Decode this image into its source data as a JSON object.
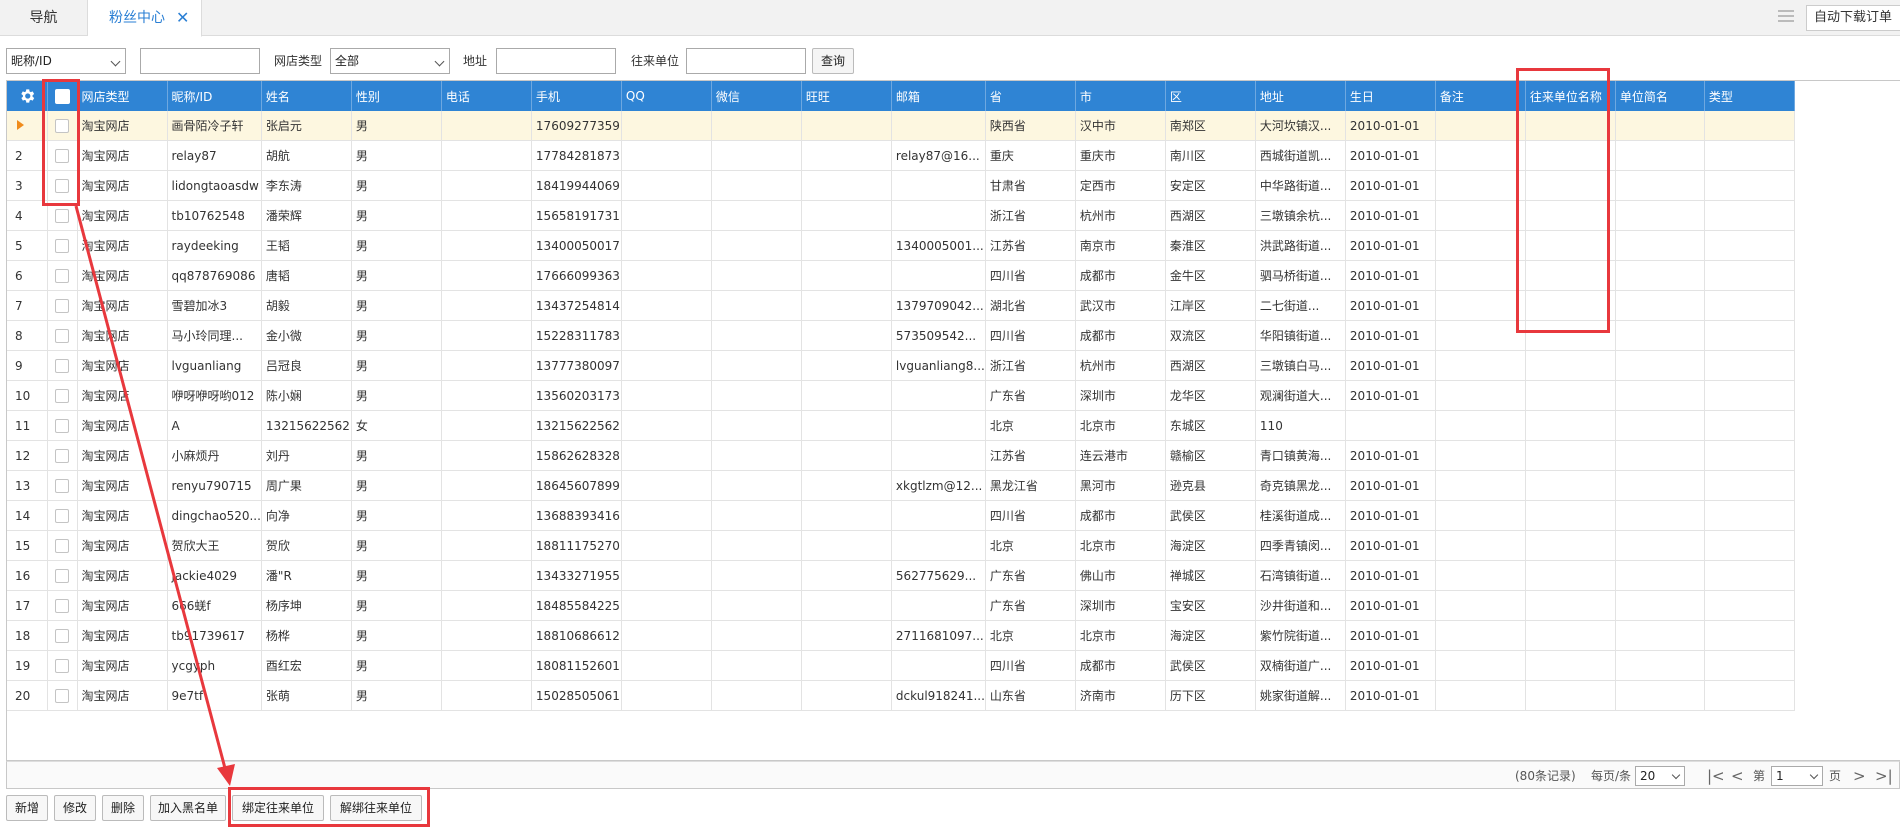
{
  "tabs": [
    {
      "label": "导航",
      "active": false
    },
    {
      "label": "粉丝中心",
      "active": true,
      "closable": true
    }
  ],
  "tab_close_glyph": "✕",
  "top_right": {
    "auto_download_label": "自动下载订单",
    "list_icon": "list-icon"
  },
  "filter": {
    "field_select": "昵称/ID",
    "keyword_value": "",
    "shop_type_label": "网店类型",
    "shop_type_value": "全部",
    "address_label": "地址",
    "address_value": "",
    "partner_label": "往来单位",
    "partner_value": "",
    "query_button": "查询"
  },
  "grid": {
    "gear_icon": "gear-icon",
    "columns": [
      "网店类型",
      "昵称/ID",
      "姓名",
      "性别",
      "电话",
      "手机",
      "QQ",
      "微信",
      "旺旺",
      "邮箱",
      "省",
      "市",
      "区",
      "地址",
      "生日",
      "备注",
      "往来单位名称",
      "单位简名",
      "类型"
    ],
    "selected_row": 0,
    "rows": [
      {
        "idx": "1",
        "c": [
          "淘宝网店",
          "画骨陌冷子轩",
          "张启元",
          "男",
          "",
          "17609277359",
          "",
          "",
          "",
          "",
          "陕西省",
          "汉中市",
          "南郑区",
          "大河坎镇汉...",
          "2010-01-01",
          "",
          "",
          "",
          ""
        ]
      },
      {
        "idx": "2",
        "c": [
          "淘宝网店",
          "relay87",
          "胡航",
          "男",
          "",
          "17784281873",
          "",
          "",
          "",
          "relay87@16...",
          "重庆",
          "重庆市",
          "南川区",
          "西城街道凯...",
          "2010-01-01",
          "",
          "",
          "",
          ""
        ]
      },
      {
        "idx": "3",
        "c": [
          "淘宝网店",
          "lidongtaoasdw",
          "李东涛",
          "男",
          "",
          "18419944069",
          "",
          "",
          "",
          "",
          "甘肃省",
          "定西市",
          "安定区",
          "中华路街道...",
          "2010-01-01",
          "",
          "",
          "",
          ""
        ]
      },
      {
        "idx": "4",
        "c": [
          "淘宝网店",
          "tb10762548",
          "潘荣辉",
          "男",
          "",
          "15658191731",
          "",
          "",
          "",
          "",
          "浙江省",
          "杭州市",
          "西湖区",
          "三墩镇余杭...",
          "2010-01-01",
          "",
          "",
          "",
          ""
        ]
      },
      {
        "idx": "5",
        "c": [
          "淘宝网店",
          "raydeeking",
          "王韬",
          "男",
          "",
          "13400050017",
          "",
          "",
          "",
          "1340005001...",
          "江苏省",
          "南京市",
          "秦淮区",
          "洪武路街道...",
          "2010-01-01",
          "",
          "",
          "",
          ""
        ]
      },
      {
        "idx": "6",
        "c": [
          "淘宝网店",
          "qq878769086",
          "唐韬",
          "男",
          "",
          "17666099363",
          "",
          "",
          "",
          "",
          "四川省",
          "成都市",
          "金牛区",
          "驷马桥街道...",
          "2010-01-01",
          "",
          "",
          "",
          ""
        ]
      },
      {
        "idx": "7",
        "c": [
          "淘宝网店",
          "雪碧加冰3",
          "胡毅",
          "男",
          "",
          "13437254814",
          "",
          "",
          "",
          "1379709042...",
          "湖北省",
          "武汉市",
          "江岸区",
          "二七街道...",
          "2010-01-01",
          "",
          "",
          "",
          ""
        ]
      },
      {
        "idx": "8",
        "c": [
          "淘宝网店",
          "马小玲同理...",
          "金小微",
          "男",
          "",
          "15228311783",
          "",
          "",
          "",
          "573509542...",
          "四川省",
          "成都市",
          "双流区",
          "华阳镇街道...",
          "2010-01-01",
          "",
          "",
          "",
          ""
        ]
      },
      {
        "idx": "9",
        "c": [
          "淘宝网店",
          "lvguanliang",
          "吕冠良",
          "男",
          "",
          "13777380097",
          "",
          "",
          "",
          "lvguanliang8...",
          "浙江省",
          "杭州市",
          "西湖区",
          "三墩镇白马...",
          "2010-01-01",
          "",
          "",
          "",
          ""
        ]
      },
      {
        "idx": "10",
        "c": [
          "淘宝网店",
          "咿呀咿呀哟012",
          "陈小娴",
          "男",
          "",
          "13560203173",
          "",
          "",
          "",
          "",
          "广东省",
          "深圳市",
          "龙华区",
          "观澜街道大...",
          "2010-01-01",
          "",
          "",
          "",
          ""
        ]
      },
      {
        "idx": "11",
        "c": [
          "淘宝网店",
          "A",
          "13215622562",
          "女",
          "",
          "13215622562",
          "",
          "",
          "",
          "",
          "北京",
          "北京市",
          "东城区",
          "110",
          "",
          "",
          "",
          "",
          ""
        ]
      },
      {
        "idx": "12",
        "c": [
          "淘宝网店",
          "小麻烦丹",
          "刘丹",
          "男",
          "",
          "15862628328",
          "",
          "",
          "",
          "",
          "江苏省",
          "连云港市",
          "赣榆区",
          "青口镇黄海...",
          "2010-01-01",
          "",
          "",
          "",
          ""
        ]
      },
      {
        "idx": "13",
        "c": [
          "淘宝网店",
          "renyu790715",
          "周广果",
          "男",
          "",
          "18645607899",
          "",
          "",
          "",
          "xkgtlzm@12...",
          "黑龙江省",
          "黑河市",
          "逊克县",
          "奇克镇黑龙...",
          "2010-01-01",
          "",
          "",
          "",
          ""
        ]
      },
      {
        "idx": "14",
        "c": [
          "淘宝网店",
          "dingchao520...",
          "向净",
          "男",
          "",
          "13688393416",
          "",
          "",
          "",
          "",
          "四川省",
          "成都市",
          "武侯区",
          "桂溪街道成...",
          "2010-01-01",
          "",
          "",
          "",
          ""
        ]
      },
      {
        "idx": "15",
        "c": [
          "淘宝网店",
          "贺欣大王",
          "贺欣",
          "男",
          "",
          "18811175270",
          "",
          "",
          "",
          "",
          "北京",
          "北京市",
          "海淀区",
          "四季青镇闵...",
          "2010-01-01",
          "",
          "",
          "",
          ""
        ]
      },
      {
        "idx": "16",
        "c": [
          "淘宝网店",
          "jackie4029",
          "潘\"R",
          "男",
          "",
          "13433271955",
          "",
          "",
          "",
          "562775629...",
          "广东省",
          "佛山市",
          "禅城区",
          "石湾镇街道...",
          "2010-01-01",
          "",
          "",
          "",
          ""
        ]
      },
      {
        "idx": "17",
        "c": [
          "淘宝网店",
          "666蜣f",
          "杨序坤",
          "男",
          "",
          "18485584225",
          "",
          "",
          "",
          "",
          "广东省",
          "深圳市",
          "宝安区",
          "沙井街道和...",
          "2010-01-01",
          "",
          "",
          "",
          ""
        ]
      },
      {
        "idx": "18",
        "c": [
          "淘宝网店",
          "tb91739617",
          "杨桦",
          "男",
          "",
          "18810686612",
          "",
          "",
          "",
          "2711681097...",
          "北京",
          "北京市",
          "海淀区",
          "紫竹院街道...",
          "2010-01-01",
          "",
          "",
          "",
          ""
        ]
      },
      {
        "idx": "19",
        "c": [
          "淘宝网店",
          "ycgyph",
          "酉红宏",
          "男",
          "",
          "18081152601",
          "",
          "",
          "",
          "",
          "四川省",
          "成都市",
          "武侯区",
          "双楠街道广...",
          "2010-01-01",
          "",
          "",
          "",
          ""
        ]
      },
      {
        "idx": "20",
        "c": [
          "淘宝网店",
          "9e7tf",
          "张萌",
          "男",
          "",
          "15028505061",
          "",
          "",
          "",
          "dckul918241...",
          "山东省",
          "济南市",
          "历下区",
          "姚家街道解...",
          "2010-01-01",
          "",
          "",
          "",
          ""
        ]
      }
    ]
  },
  "pager": {
    "records": "(80条记录)",
    "per_page_label": "每页/条",
    "per_page_value": "20",
    "first_icon": "|<",
    "prev_icon": "<",
    "page_prefix": "第",
    "page_value": "1",
    "page_suffix": "页",
    "next_icon": ">",
    "last_icon": ">|"
  },
  "actions": [
    "新增",
    "修改",
    "删除",
    "加入黑名单",
    "绑定往来单位",
    "解绑往来单位"
  ],
  "annotation_color": "#e8383d"
}
